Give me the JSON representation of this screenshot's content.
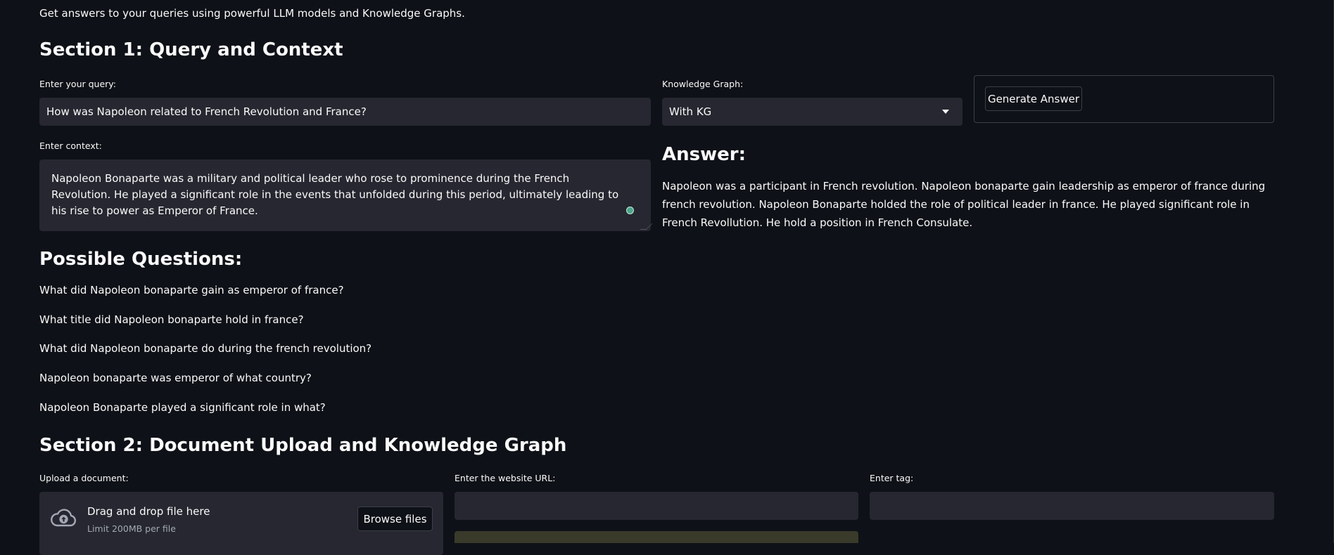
{
  "page": {
    "subtitle": "Get answers to your queries using powerful LLM models and Knowledge Graphs."
  },
  "section1": {
    "title": "Section 1: Query and Context",
    "query_label": "Enter your query:",
    "query_value": "How was Napoleon related to French Revolution and France?",
    "kg_label": "Knowledge Graph:",
    "kg_selected": "With KG",
    "generate_label": "Generate Answer",
    "context_label": "Enter context:",
    "context_value": "Napoleon Bonaparte was a military and political leader who rose to prominence during the French Revolution. He played a significant role in the events that unfolded during this period, ultimately leading to his rise to power as Emperor of France.",
    "answer_title": "Answer:",
    "answer_text": "Napoleon was a participant in French revolution. Napoleon bonaparte gain leadership as emperor of france during french revolution. Napoleon Bonaparte holded the role of political leader in france. He played significant role in French Revollution. He hold a position in French Consulate.",
    "questions_title": "Possible Questions:",
    "questions": [
      "What did Napoleon bonaparte gain as emperor of france?",
      "What title did Napoleon bonaparte hold in france?",
      "What did Napoleon bonaparte do during the french revolution?",
      "Napoleon bonaparte was emperor of what country?",
      "Napoleon Bonaparte played a significant role in what?"
    ]
  },
  "section2": {
    "title": "Section 2: Document Upload and Knowledge Graph",
    "upload_label": "Upload a document:",
    "dropzone_title": "Drag and drop file here",
    "dropzone_limit": "Limit 200MB per file",
    "browse_label": "Browse files",
    "url_label": "Enter the website URL:",
    "url_value": "",
    "tag_label": "Enter tag:",
    "tag_value": ""
  },
  "colors": {
    "background": "#0e1117",
    "input_bg": "#262730",
    "border": "#3d3f49",
    "text": "#fafafa",
    "muted": "#a3a8b4",
    "partial_button": "#3a3a2a"
  },
  "icons": {
    "select_caret": "chevron-down-icon",
    "upload": "cloud-upload-icon"
  }
}
